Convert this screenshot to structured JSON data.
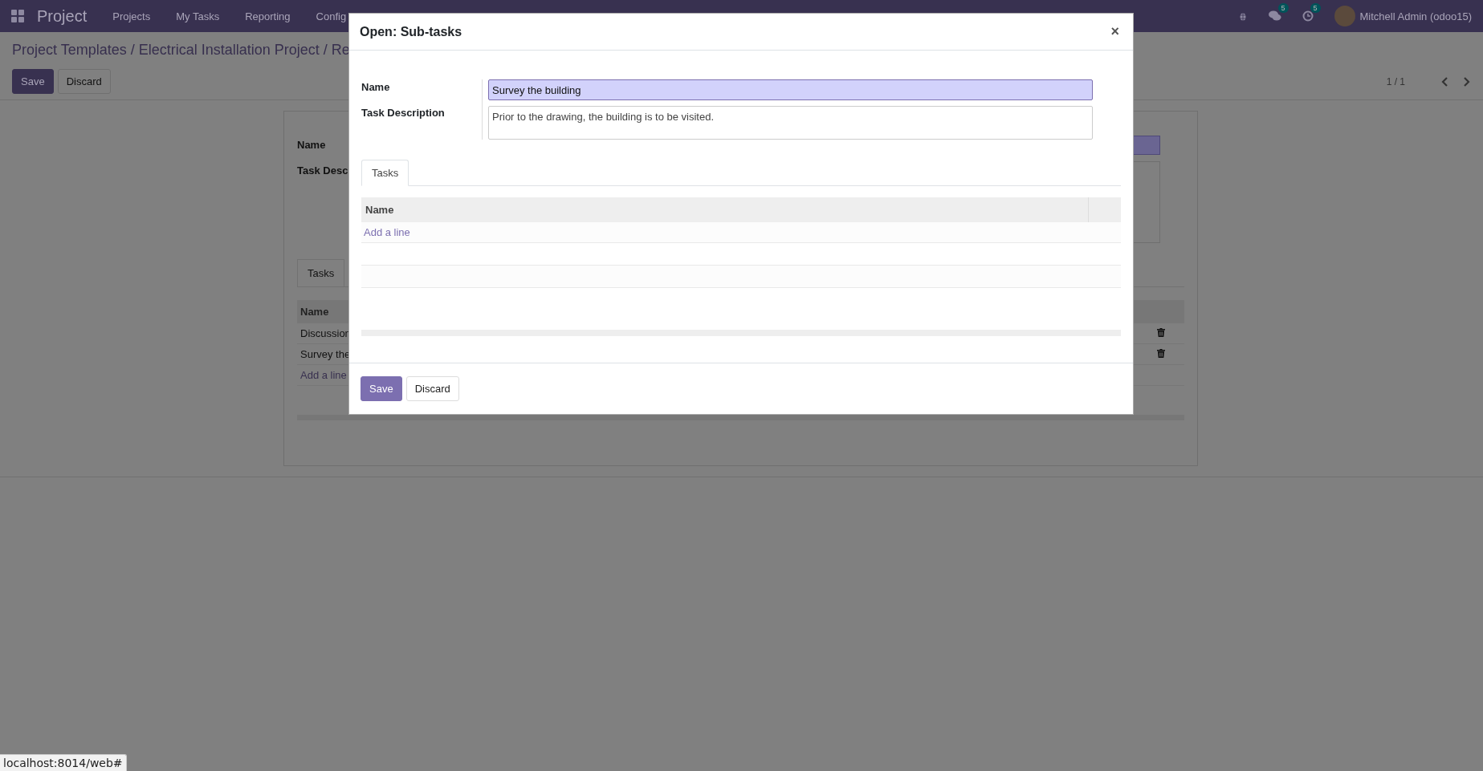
{
  "navbar": {
    "app_name": "Project",
    "menu": [
      "Projects",
      "My Tasks",
      "Reporting",
      "Config"
    ],
    "messages_badge": "5",
    "activities_badge": "5",
    "user": "Mitchell Admin (odoo15)"
  },
  "breadcrumb": "Project Templates / Electrical Installation Project / Re",
  "control_panel": {
    "buttons": [
      {
        "label": "Save",
        "kind": "primary"
      },
      {
        "label": "Discard",
        "kind": "secondary"
      }
    ],
    "pager": "1 / 1"
  },
  "form": {
    "fields": [
      {
        "label": "Name"
      },
      {
        "label": "Task Desc"
      }
    ],
    "tabs": [
      {
        "label": "Tasks",
        "selected": true
      }
    ],
    "table": {
      "columns": [
        "Name"
      ],
      "rows": [
        "Discussion",
        "Survey the"
      ],
      "add_line": "Add a line"
    }
  },
  "dialog": {
    "title": "Open: Sub-tasks",
    "close": "×",
    "name": {
      "label": "Name",
      "value": "Survey the building"
    },
    "description": {
      "label": "Task Description",
      "value": "Prior to the drawing, the building is to be visited."
    },
    "tabs": [
      {
        "label": "Tasks",
        "selected": true
      }
    ],
    "table": {
      "columns": [
        "Name"
      ],
      "add_line": "Add a line"
    },
    "buttons": [
      {
        "label": "Save",
        "kind": "primary"
      },
      {
        "label": "Discard",
        "kind": "secondary"
      }
    ]
  },
  "status_bar": "localhost:8014/web#"
}
